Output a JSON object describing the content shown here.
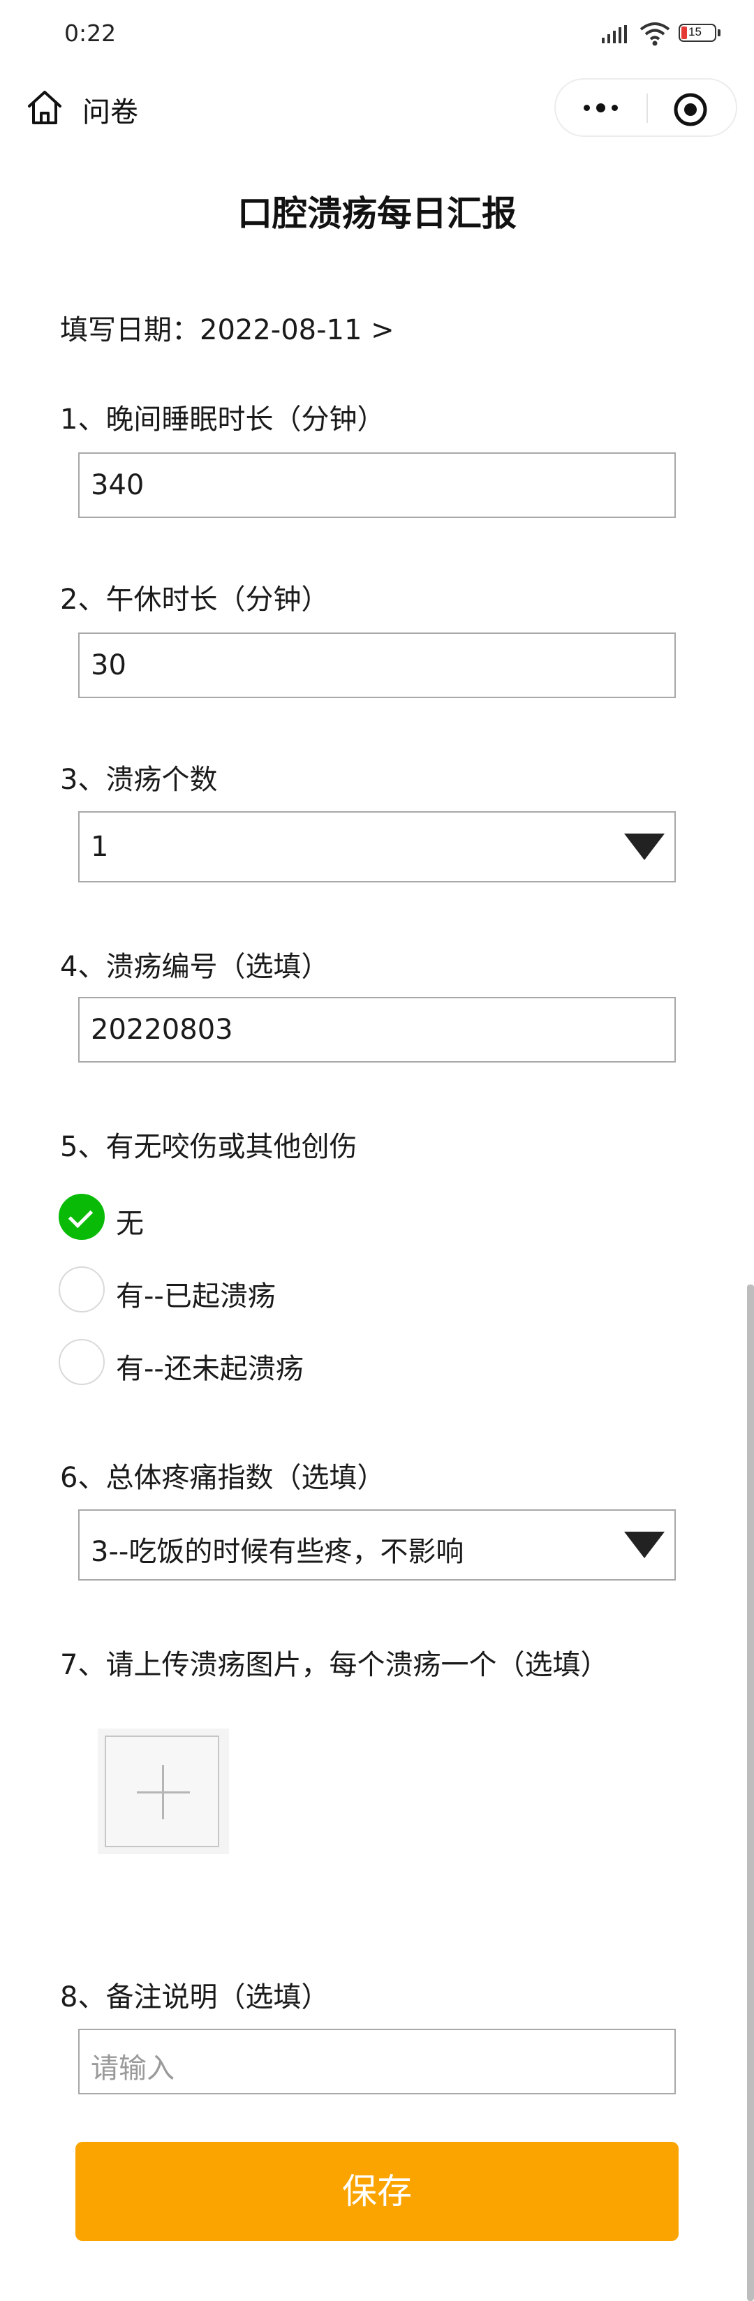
{
  "status_bar": {
    "time": "0:22",
    "battery_level": "15",
    "icons": [
      "signal-icon",
      "wifi-icon",
      "battery-icon"
    ]
  },
  "nav": {
    "title": "问卷",
    "icons": [
      "home-icon",
      "more-icon",
      "target-icon"
    ]
  },
  "form": {
    "title": "口腔溃疡每日汇报",
    "date_label": "填写日期：2022-08-11 >",
    "q1": {
      "label": "1、晚间睡眠时长（分钟）",
      "value": "340"
    },
    "q2": {
      "label": "2、午休时长（分钟）",
      "value": "30"
    },
    "q3": {
      "label": "3、溃疡个数",
      "value": "1"
    },
    "q4": {
      "label": "4、溃疡编号（选填）",
      "value": "20220803"
    },
    "q5": {
      "label": "5、有无咬伤或其他创伤",
      "options": [
        "无",
        "有--已起溃疡",
        "有--还未起溃疡"
      ],
      "selected_index": 0
    },
    "q6": {
      "label": "6、总体疼痛指数（选填）",
      "value": "3--吃饭的时候有些疼，不影响"
    },
    "q7": {
      "label": "7、请上传溃疡图片，每个溃疡一个（选填）"
    },
    "q8": {
      "label": "8、备注说明（选填）",
      "placeholder": "请输入"
    },
    "save_label": "保存"
  },
  "colors": {
    "accent_orange": "#fba400",
    "check_green": "#09bb07",
    "battery_low": "#e53935"
  }
}
